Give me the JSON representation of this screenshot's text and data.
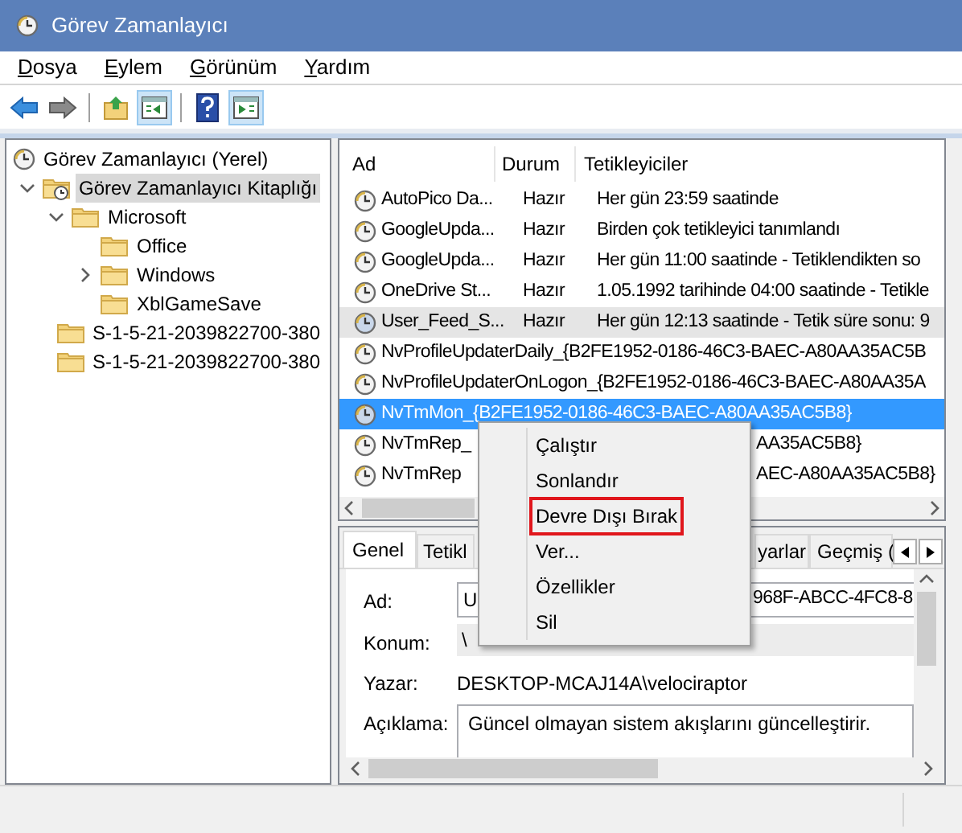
{
  "window": {
    "title": "Görev Zamanlayıcı"
  },
  "menu": [
    "Dosya",
    "Eylem",
    "Görünüm",
    "Yardım"
  ],
  "toolbar": [
    {
      "pressed": false
    },
    {
      "pressed": false
    },
    {
      "pressed": false
    },
    {
      "pressed": true
    },
    {
      "pressed": false
    },
    {
      "pressed": true
    }
  ],
  "tree": [
    {
      "label": "Görev Zamanlayıcı (Yerel)",
      "selected": false,
      "children": [
        {
          "label": "Görev Zamanlayıcı Kitaplığı",
          "expanded": true,
          "selected": true,
          "children": [
            {
              "label": "Microsoft",
              "expanded": true,
              "selected": false,
              "children": [
                {
                  "label": "Office",
                  "selected": false
                },
                {
                  "label": "Windows",
                  "expanded": false,
                  "selected": false
                },
                {
                  "label": "XblGameSave",
                  "selected": false
                }
              ]
            },
            {
              "label": "S-1-5-21-2039822700-380",
              "selected": false
            },
            {
              "label": "S-1-5-21-2039822700-380",
              "selected": false
            }
          ]
        }
      ]
    }
  ],
  "table": {
    "columns": [
      "Ad",
      "Durum",
      "Tetikleyiciler"
    ],
    "rows": [
      {
        "kind": "columns",
        "name": "AutoPico Da...",
        "status": "Hazır",
        "trigger": "Her gün 23:59 saatinde",
        "selected": false,
        "hovered": false
      },
      {
        "kind": "columns",
        "name": "GoogleUpda...",
        "status": "Hazır",
        "trigger": "Birden çok tetikleyici tanımlandı",
        "selected": false,
        "hovered": false
      },
      {
        "kind": "columns",
        "name": "GoogleUpda...",
        "status": "Hazır",
        "trigger": "Her gün 11:00 saatinde - Tetiklendikten so",
        "selected": false,
        "hovered": false
      },
      {
        "kind": "columns",
        "name": "OneDrive St...",
        "status": "Hazır",
        "trigger": "1.05.1992 tarihinde 04:00 saatinde - Tetikle",
        "selected": false,
        "hovered": false
      },
      {
        "kind": "columns",
        "name": "User_Feed_S...",
        "status": "Hazır",
        "trigger": "Her gün 12:13 saatinde - Tetik süre sonu: 9",
        "selected": false,
        "hovered": true
      },
      {
        "kind": "wide",
        "name": "NvProfileUpdaterDaily_{B2FE1952-0186-46C3-BAEC-A80AA35AC5B",
        "selected": false,
        "hovered": false
      },
      {
        "kind": "wide",
        "name": "NvProfileUpdaterOnLogon_{B2FE1952-0186-46C3-BAEC-A80AA35A",
        "selected": false,
        "hovered": false
      },
      {
        "kind": "wide",
        "name": "NvTmMon_{B2FE1952-0186-46C3-BAEC-A80AA35AC5B8}",
        "selected": true,
        "hovered": false
      },
      {
        "kind": "split",
        "name": "NvTmRep_",
        "name_end": "AA35AC5B8}",
        "selected": false,
        "hovered": false
      },
      {
        "kind": "split",
        "name": "NvTmRep",
        "name_end": "AEC-A80AA35AC5B8}",
        "selected": false,
        "hovered": false
      }
    ]
  },
  "details": {
    "tabs": [
      {
        "label": "Genel",
        "selected": true
      },
      {
        "label": "Tetikl",
        "selected": false
      },
      {
        "label": "yarlar",
        "selected": false
      },
      {
        "label": "Geçmiş (",
        "selected": false
      }
    ],
    "fields": [
      {
        "label": "Ad:",
        "kind": "input",
        "value": "U",
        "value_end": "968F-ABCC-4FC8-8"
      },
      {
        "label": "Konum:",
        "kind": "readonly",
        "value": "\\"
      },
      {
        "label": "Yazar:",
        "kind": "text",
        "value": "DESKTOP-MCAJ14A\\velociraptor"
      },
      {
        "label": "Açıklama:",
        "kind": "textarea",
        "value": "Güncel olmayan sistem akışlarını güncelleştirir."
      }
    ]
  },
  "context_menu": [
    {
      "label": "Çalıştır",
      "highlighted": false
    },
    {
      "label": "Sonlandır",
      "highlighted": false
    },
    {
      "label": "Devre Dışı Bırak",
      "highlighted": true
    },
    {
      "label": "Ver...",
      "highlighted": false
    },
    {
      "label": "Özellikler",
      "highlighted": false
    },
    {
      "label": "Sil",
      "highlighted": false
    }
  ]
}
